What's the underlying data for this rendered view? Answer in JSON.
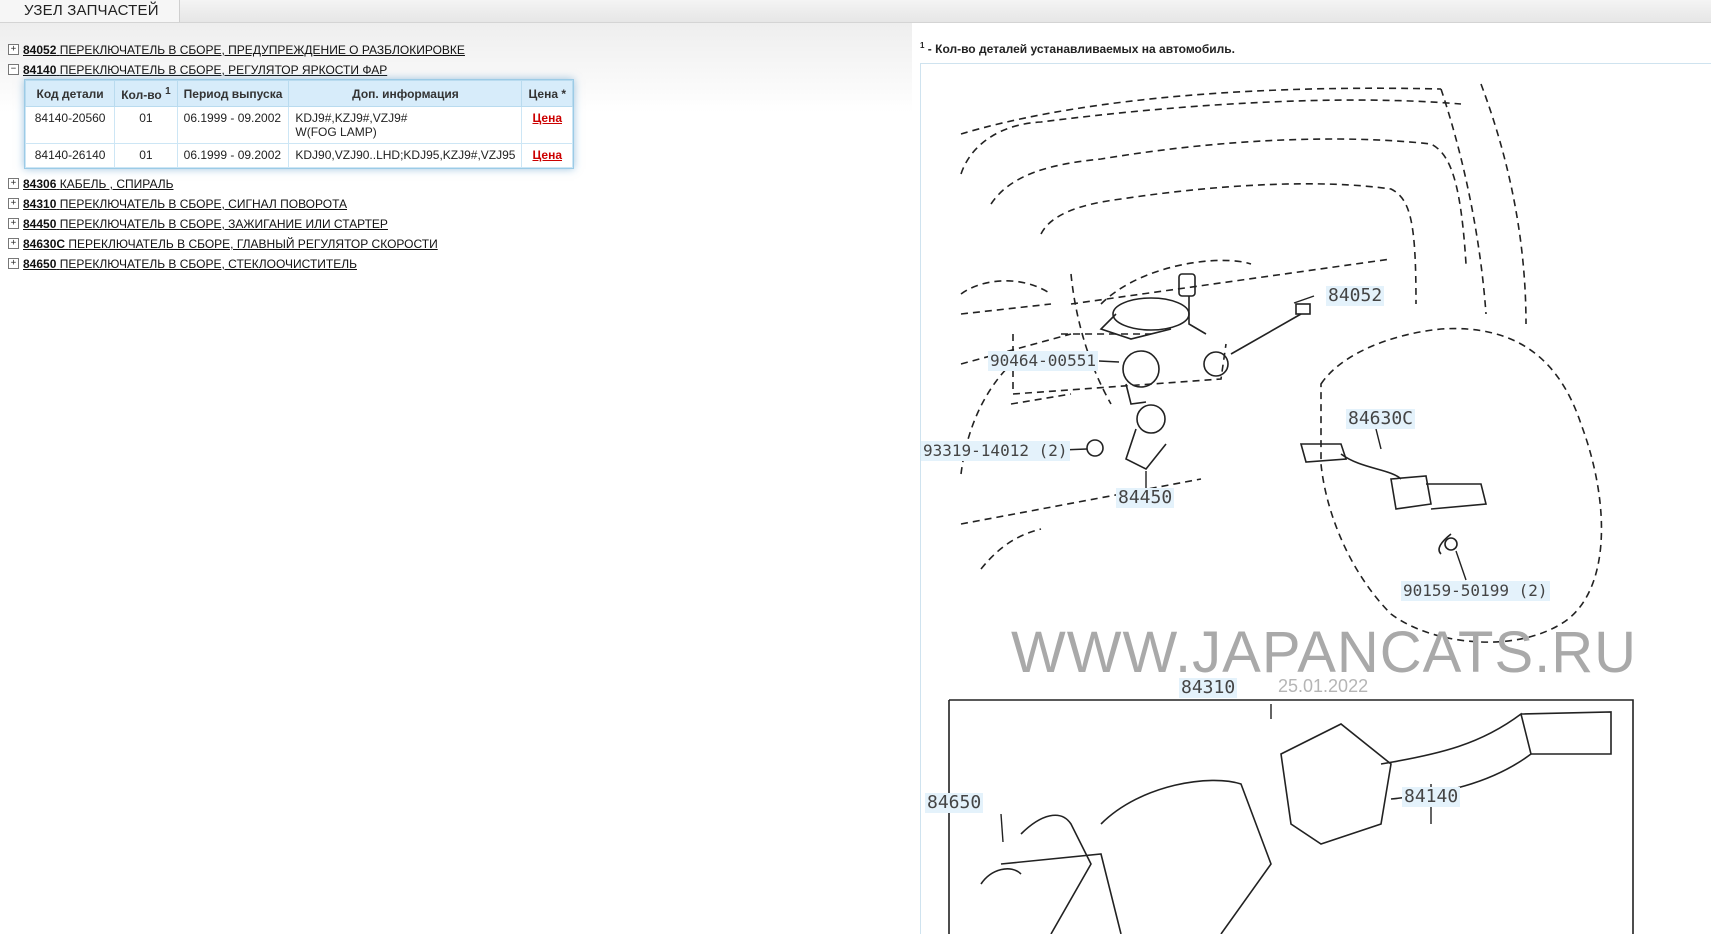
{
  "header": {
    "tab_label": "УЗЕЛ ЗАПЧАСТЕЙ"
  },
  "tree": {
    "nodes": [
      {
        "code": "84052",
        "name": "ПЕРЕКЛЮЧАТЕЛЬ В СБОРЕ, ПРЕДУПРЕЖДЕНИЕ О РАЗБЛОКИРОВКЕ",
        "toggle": "+"
      },
      {
        "code": "84140",
        "name": "ПЕРЕКЛЮЧАТЕЛЬ В СБОРЕ, РЕГУЛЯТОР ЯРКОСТИ ФАР",
        "toggle": "−"
      },
      {
        "code": "84306",
        "name": "КАБЕЛЬ , СПИРАЛЬ",
        "toggle": "+"
      },
      {
        "code": "84310",
        "name": "ПЕРЕКЛЮЧАТЕЛЬ В СБОРЕ, СИГНАЛ ПОВОРОТА",
        "toggle": "+"
      },
      {
        "code": "84450",
        "name": "ПЕРЕКЛЮЧАТЕЛЬ В СБОРЕ, ЗАЖИГАНИЕ ИЛИ СТАРТЕР",
        "toggle": "+"
      },
      {
        "code": "84630C",
        "name": "ПЕРЕКЛЮЧАТЕЛЬ В СБОРЕ, ГЛАВНЫЙ РЕГУЛЯТОР СКОРОСТИ",
        "toggle": "+"
      },
      {
        "code": "84650",
        "name": "ПЕРЕКЛЮЧАТЕЛЬ В СБОРЕ, СТЕКЛООЧИСТИТЕЛЬ",
        "toggle": "+"
      }
    ]
  },
  "parts_table": {
    "headers": {
      "code": "Код детали",
      "qty": "Кол-во",
      "qty_sup": "1",
      "period": "Период выпуска",
      "info": "Доп. информация",
      "price": "Цена *"
    },
    "rows": [
      {
        "code": "84140-20560",
        "qty": "01",
        "period": "06.1999 - 09.2002",
        "info1": "KDJ9#,KZJ9#,VZJ9#",
        "info2": "W(FOG LAMP)",
        "price": "Цена"
      },
      {
        "code": "84140-26140",
        "qty": "01",
        "period": "06.1999 - 09.2002",
        "info1": "KDJ90,VZJ90..LHD;KDJ95,KZJ9#,VZJ95",
        "info2": "",
        "price": "Цена"
      }
    ]
  },
  "footnote": {
    "sup": "1",
    "text": " - Кол-во деталей устанавливаемых на автомобиль."
  },
  "diagram": {
    "labels": {
      "p84052": "84052",
      "p90464": "90464-00551",
      "p93319": "93319-14012 (2)",
      "p84450": "84450",
      "p84630c": "84630C",
      "p90159": "90159-50199 (2)",
      "p84310": "84310",
      "p84650": "84650",
      "p84140": "84140"
    },
    "watermark": "WWW.JAPANCATS.RU",
    "date": "25.01.2022"
  }
}
